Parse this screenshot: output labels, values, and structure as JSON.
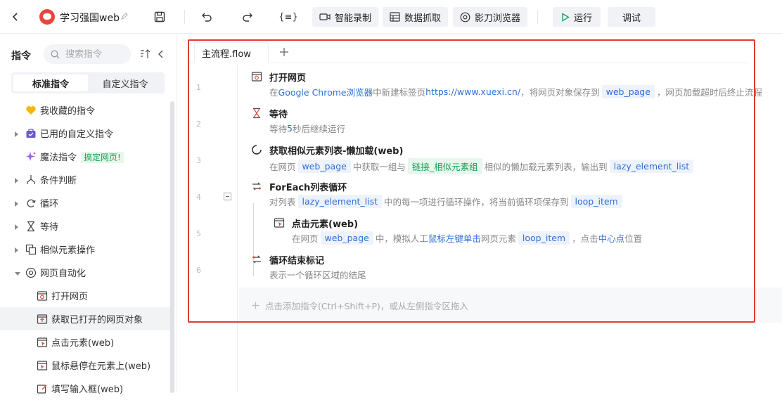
{
  "app": {
    "title": "学习强国web"
  },
  "toolbar": {
    "variables_label": "{≡}",
    "smart_record": "智能录制",
    "data_capture": "数据抓取",
    "browser": "影刀浏览器",
    "run": "运行",
    "debug": "调试"
  },
  "sidebar": {
    "title": "指令",
    "search_placeholder": "搜索指令",
    "tabs": [
      "标准指令",
      "自定义指令"
    ],
    "items": [
      {
        "label": "我收藏的指令",
        "icon": "heart-icon"
      },
      {
        "label": "已用的自定义指令",
        "icon": "briefcase-icon"
      },
      {
        "label": "魔法指令",
        "icon": "sparkle-icon",
        "tag": "搞定网页!"
      },
      {
        "label": "条件判断",
        "icon": "branch-icon"
      },
      {
        "label": "循环",
        "icon": "loop-icon"
      },
      {
        "label": "等待",
        "icon": "hourglass-icon"
      },
      {
        "label": "相似元素操作",
        "icon": "copy-icon"
      },
      {
        "label": "网页自动化",
        "icon": "chrome-icon"
      }
    ],
    "children": [
      {
        "label": "打开网页",
        "icon": "browser-window-icon"
      },
      {
        "label": "获取已打开的网页对象",
        "icon": "browser-window-icon"
      },
      {
        "label": "点击元素(web)",
        "icon": "browser-click-icon"
      },
      {
        "label": "鼠标悬停在元素上(web)",
        "icon": "browser-hover-icon"
      },
      {
        "label": "填写输入框(web)",
        "icon": "edit-box-icon"
      }
    ]
  },
  "editor": {
    "tab_label": "主流程.flow",
    "line_numbers": [
      "1",
      "2",
      "3",
      "4",
      "5",
      "6"
    ],
    "steps": [
      {
        "title": "打开网页",
        "desc": [
          {
            "t": "在 "
          },
          {
            "t": "Google Chrome浏览器",
            "c": "hl"
          },
          {
            "t": " 中新建标签页 "
          },
          {
            "t": "https://www.xuexi.cn/",
            "c": "hl"
          },
          {
            "t": " ，将网页对象保存到 "
          },
          {
            "t": "web_page",
            "c": "chip"
          },
          {
            "t": " ，网页加载超时后终止流程"
          }
        ]
      },
      {
        "title": "等待",
        "desc": [
          {
            "t": "等待 "
          },
          {
            "t": "5",
            "c": "hl"
          },
          {
            "t": " 秒后继续运行"
          }
        ]
      },
      {
        "title": "获取相似元素列表-懒加载(web)",
        "desc": [
          {
            "t": "在网页 "
          },
          {
            "t": "web_page",
            "c": "chip"
          },
          {
            "t": " 中获取一组与 "
          },
          {
            "t": "链接_相似元素组",
            "c": "chip green"
          },
          {
            "t": " 相似的懒加载元素列表，输出到 "
          },
          {
            "t": "lazy_element_list",
            "c": "chip"
          }
        ]
      },
      {
        "title": "ForEach列表循环",
        "desc": [
          {
            "t": "对列表 "
          },
          {
            "t": "lazy_element_list",
            "c": "chip"
          },
          {
            "t": " 中的每一项进行循环操作，将当前循环项保存到 "
          },
          {
            "t": "loop_item",
            "c": "chip"
          }
        ]
      },
      {
        "title": "点击元素(web)",
        "desc": [
          {
            "t": "在网页 "
          },
          {
            "t": "web_page",
            "c": "chip"
          },
          {
            "t": " 中，模拟人工 "
          },
          {
            "t": "鼠标左键",
            "c": "hl"
          },
          {
            "t": " "
          },
          {
            "t": "单击",
            "c": "hl"
          },
          {
            "t": " 网页元素 "
          },
          {
            "t": "loop_item",
            "c": "chip"
          },
          {
            "t": " ，点击 "
          },
          {
            "t": "中心点",
            "c": "hl"
          },
          {
            "t": " 位置"
          }
        ]
      },
      {
        "title": "循环结束标记",
        "desc": [
          {
            "t": "表示一个循环区域的结尾"
          }
        ]
      }
    ],
    "add_hint": "点击添加指令(Ctrl+Shift+P)，或从左侧指令区拖入"
  },
  "colors": {
    "accent": "#2f6fd6",
    "highlight_box": "#e23a33",
    "run_icon": "#1aa35a"
  }
}
